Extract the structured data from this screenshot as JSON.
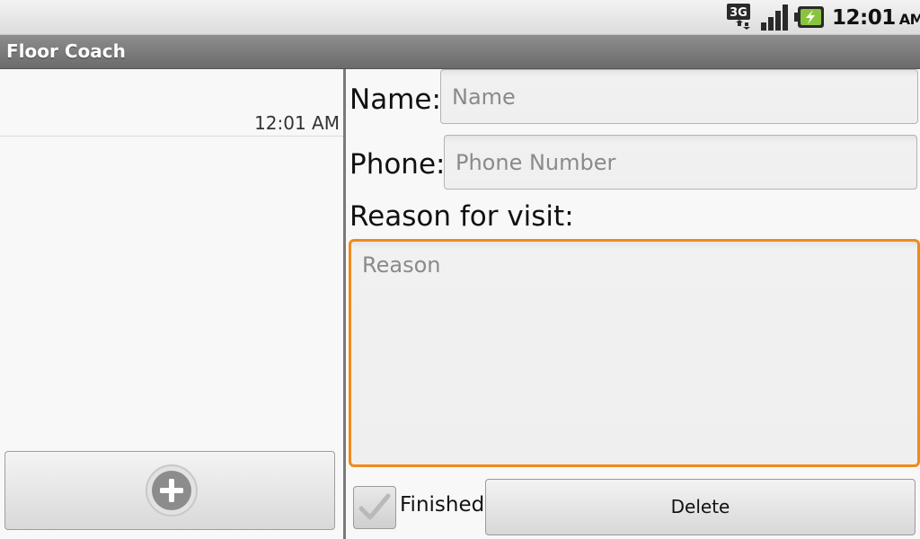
{
  "status_bar": {
    "network_label": "3G",
    "time": "12:01",
    "ampm": "AM"
  },
  "app": {
    "title": "Floor Coach"
  },
  "list": {
    "items": [
      {
        "time": "12:01 AM"
      }
    ],
    "add_button_icon": "plus-circle-icon"
  },
  "form": {
    "name_label": "Name:",
    "name_placeholder": "Name",
    "phone_label": "Phone:",
    "phone_placeholder": "Phone Number",
    "reason_label": "Reason for visit:",
    "reason_placeholder": "Reason",
    "finished_label": "Finished",
    "finished_checked": true,
    "delete_label": "Delete"
  },
  "colors": {
    "focus_border": "#f08a1c",
    "title_bar": "#7a7a7a",
    "battery_charge": "#8ac43f"
  }
}
